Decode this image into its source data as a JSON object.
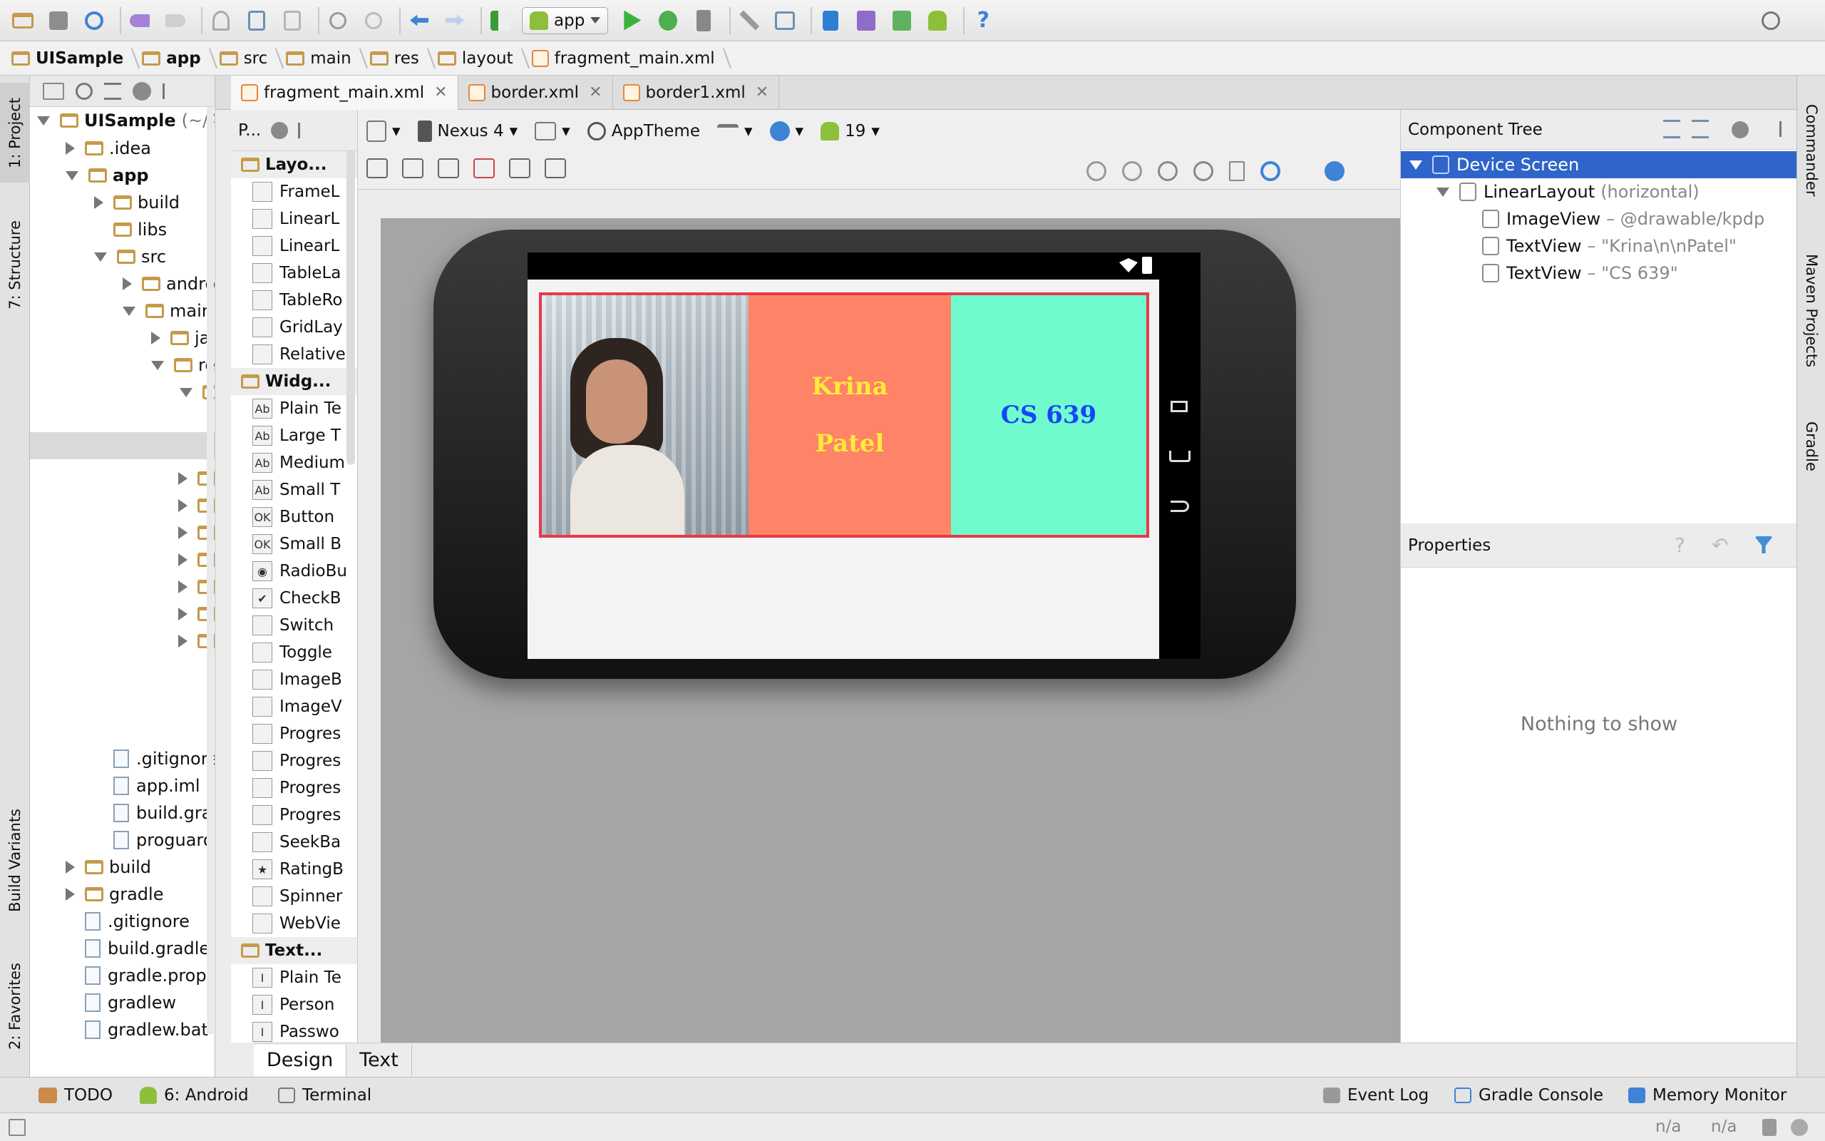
{
  "toolbar": {
    "run_config": "app",
    "icons": [
      "open-folder-icon",
      "save-icon",
      "sync-icon",
      "undo-icon",
      "redo-icon",
      "cut-icon",
      "copy-icon",
      "paste-icon",
      "find-icon",
      "replace-icon",
      "back-icon",
      "forward-icon",
      "make-icon",
      "run-icon",
      "debug-icon",
      "attach-debugger-icon",
      "settings-icon",
      "project-structure-icon",
      "avd-manager-icon",
      "sdk-manager-icon",
      "sync-gradle-icon",
      "android-monitor-icon",
      "help-icon",
      "search-everywhere-icon"
    ]
  },
  "breadcrumb": [
    "UISample",
    "app",
    "src",
    "main",
    "res",
    "layout",
    "fragment_main.xml"
  ],
  "left_strip": {
    "project": "1: Project",
    "structure": "7: Structure",
    "build_variants": "Build Variants",
    "favorites": "2: Favorites"
  },
  "right_strip": {
    "commander": "Commander",
    "maven": "Maven Projects",
    "gradle": "Gradle"
  },
  "project_tree": [
    {
      "label": "UISample",
      "suffix": "(~/A",
      "depth": 0,
      "arrow": "down",
      "bold": true
    },
    {
      "label": ".idea",
      "depth": 1,
      "arrow": "right"
    },
    {
      "label": "app",
      "depth": 1,
      "arrow": "down",
      "bold": true
    },
    {
      "label": "build",
      "depth": 2,
      "arrow": "right"
    },
    {
      "label": "libs",
      "depth": 2,
      "arrow": "none"
    },
    {
      "label": "src",
      "depth": 2,
      "arrow": "down"
    },
    {
      "label": "andro",
      "depth": 3,
      "arrow": "right"
    },
    {
      "label": "main",
      "depth": 3,
      "arrow": "down"
    },
    {
      "label": "ja",
      "depth": 4,
      "arrow": "right"
    },
    {
      "label": "re",
      "depth": 4,
      "arrow": "down"
    },
    {
      "label": "",
      "depth": 5,
      "arrow": "down"
    },
    {
      "label": ".gitignore",
      "depth": 2,
      "arrow": "none",
      "file": true
    },
    {
      "label": "app.iml",
      "depth": 2,
      "arrow": "none",
      "file": true
    },
    {
      "label": "build.gra",
      "depth": 2,
      "arrow": "none",
      "file": true
    },
    {
      "label": "proguard",
      "depth": 2,
      "arrow": "none",
      "file": true
    },
    {
      "label": "build",
      "depth": 1,
      "arrow": "right"
    },
    {
      "label": "gradle",
      "depth": 1,
      "arrow": "right"
    },
    {
      "label": ".gitignore",
      "depth": 1,
      "arrow": "none",
      "file": true
    },
    {
      "label": "build.gradle",
      "depth": 1,
      "arrow": "none",
      "file": true
    },
    {
      "label": "gradle.prop",
      "depth": 1,
      "arrow": "none",
      "file": true
    },
    {
      "label": "gradlew",
      "depth": 1,
      "arrow": "none",
      "file": true
    },
    {
      "label": "gradlew.bat",
      "depth": 1,
      "arrow": "none",
      "file": true
    }
  ],
  "editor_tabs": [
    {
      "label": "fragment_main.xml",
      "active": true
    },
    {
      "label": "border.xml",
      "active": false
    },
    {
      "label": "border1.xml",
      "active": false
    }
  ],
  "palette": {
    "header": "P...",
    "items": [
      {
        "type": "cat",
        "label": "Layo..."
      },
      {
        "label": "FrameL",
        "icon": ""
      },
      {
        "label": "LinearL",
        "icon": ""
      },
      {
        "label": "LinearL",
        "icon": ""
      },
      {
        "label": "TableLa",
        "icon": ""
      },
      {
        "label": "TableRo",
        "icon": ""
      },
      {
        "label": "GridLay",
        "icon": ""
      },
      {
        "label": "Relative",
        "icon": ""
      },
      {
        "type": "cat",
        "label": "Widg..."
      },
      {
        "label": "Plain Te",
        "icon": "Ab"
      },
      {
        "label": "Large T",
        "icon": "Ab"
      },
      {
        "label": "Medium",
        "icon": "Ab"
      },
      {
        "label": "Small T",
        "icon": "Ab"
      },
      {
        "label": "Button",
        "icon": "OK"
      },
      {
        "label": "Small B",
        "icon": "OK"
      },
      {
        "label": "RadioBu",
        "icon": "◉"
      },
      {
        "label": "CheckB",
        "icon": "✔"
      },
      {
        "label": "Switch",
        "icon": ""
      },
      {
        "label": "Toggle",
        "icon": ""
      },
      {
        "label": "ImageB",
        "icon": ""
      },
      {
        "label": "ImageV",
        "icon": ""
      },
      {
        "label": "Progres",
        "icon": ""
      },
      {
        "label": "Progres",
        "icon": ""
      },
      {
        "label": "Progres",
        "icon": ""
      },
      {
        "label": "Progres",
        "icon": ""
      },
      {
        "label": "SeekBa",
        "icon": ""
      },
      {
        "label": "RatingB",
        "icon": "★"
      },
      {
        "label": "Spinner",
        "icon": ""
      },
      {
        "label": "WebVie",
        "icon": ""
      },
      {
        "type": "cat",
        "label": "Text..."
      },
      {
        "label": "Plain Te",
        "icon": "I"
      },
      {
        "label": "Person",
        "icon": "I"
      },
      {
        "label": "Passwo",
        "icon": "I"
      }
    ]
  },
  "design_toolbar": {
    "device": "Nexus 4",
    "theme": "AppTheme",
    "api": "19"
  },
  "preview": {
    "name_text": "Krina",
    "name_text2": "Patel",
    "course_text": "CS 639"
  },
  "view_tabs": {
    "design": "Design",
    "text": "Text"
  },
  "component_tree": {
    "title": "Component Tree",
    "rows": [
      {
        "label": "Device Screen",
        "detail": "",
        "depth": 0,
        "selected": true
      },
      {
        "label": "LinearLayout",
        "detail": "(horizontal)",
        "depth": 1,
        "selected": false
      },
      {
        "label": "ImageView",
        "detail": "– @drawable/kpdp",
        "depth": 2,
        "selected": false
      },
      {
        "label": "TextView",
        "detail": "– \"Krina\\n\\nPatel\"",
        "depth": 2,
        "selected": false
      },
      {
        "label": "TextView",
        "detail": "– \"CS 639\"",
        "depth": 2,
        "selected": false
      }
    ]
  },
  "properties": {
    "title": "Properties",
    "empty": "Nothing to show"
  },
  "tool_windows": {
    "todo": "TODO",
    "android": "6: Android",
    "terminal": "Terminal",
    "event_log": "Event Log",
    "gradle_console": "Gradle Console",
    "memory_monitor": "Memory Monitor"
  },
  "status_bar": {
    "a": "n/a",
    "b": "n/a"
  },
  "colors": {
    "selection": "#2f65ca",
    "text_yellow": "#ffeb3b",
    "text_blue": "#1746f5",
    "bg_salmon": "#ff8366",
    "bg_mint": "#70fbce",
    "border_red": "#e8394b"
  }
}
